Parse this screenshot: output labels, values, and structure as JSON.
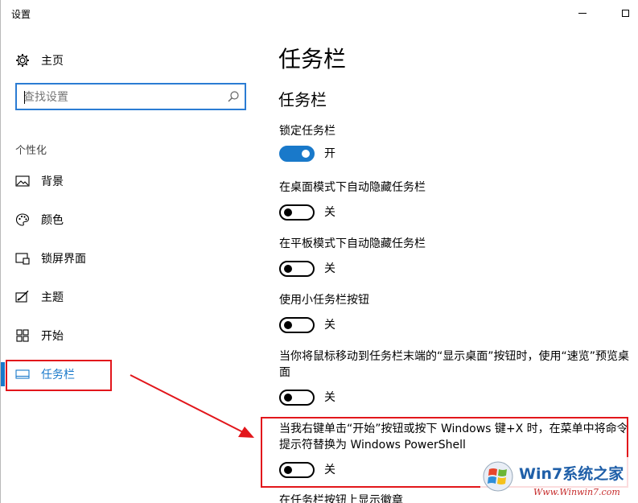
{
  "window": {
    "title": "设置"
  },
  "sidebar": {
    "home_label": "主页",
    "search": {
      "placeholder": "查找设置"
    },
    "section_label": "个性化",
    "items": [
      {
        "label": "背景",
        "icon": "picture-icon"
      },
      {
        "label": "颜色",
        "icon": "palette-icon"
      },
      {
        "label": "锁屏界面",
        "icon": "lock-screen-icon"
      },
      {
        "label": "主题",
        "icon": "theme-icon"
      },
      {
        "label": "开始",
        "icon": "start-icon"
      },
      {
        "label": "任务栏",
        "icon": "taskbar-icon",
        "active": true
      }
    ]
  },
  "main": {
    "title": "任务栏",
    "subtitle": "任务栏",
    "settings": [
      {
        "label": "锁定任务栏",
        "state": "开",
        "on": true
      },
      {
        "label": "在桌面模式下自动隐藏任务栏",
        "state": "关",
        "on": false
      },
      {
        "label": "在平板模式下自动隐藏任务栏",
        "state": "关",
        "on": false
      },
      {
        "label": "使用小任务栏按钮",
        "state": "关",
        "on": false
      },
      {
        "label": "当你将鼠标移动到任务栏末端的“显示桌面”按钮时，使用“速览”预览桌面",
        "state": "关",
        "on": false
      },
      {
        "label": "当我右键单击“开始”按钮或按下 Windows 键+X 时，在菜单中将命令提示符替换为 Windows PowerShell",
        "state": "关",
        "on": false
      },
      {
        "label": "在任务栏按钮上显示徽章"
      }
    ]
  },
  "watermark": {
    "title": "Win7系统之家",
    "url": "Www.Winwin7.com"
  },
  "colors": {
    "accent": "#1979ca",
    "highlight": "#e2161b",
    "search_border": "#2b7cd3"
  }
}
